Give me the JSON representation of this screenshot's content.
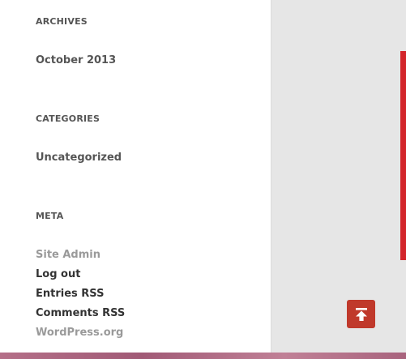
{
  "sidebar": {
    "archives": {
      "title": "ARCHIVES",
      "items": [
        "October 2013"
      ]
    },
    "categories": {
      "title": "CATEGORIES",
      "items": [
        "Uncategorized"
      ]
    },
    "meta": {
      "title": "META",
      "items": [
        "Site Admin",
        "Log out",
        "Entries RSS",
        "Comments RSS",
        "WordPress.org"
      ]
    }
  },
  "back_to_top": {
    "icon": "arrow-up-to-line-icon"
  },
  "colors": {
    "accent": "#c0392b",
    "scrollbar_thumb": "#d3252b",
    "main_bg": "#e6e6e6",
    "footer_band": "#a15a76"
  }
}
